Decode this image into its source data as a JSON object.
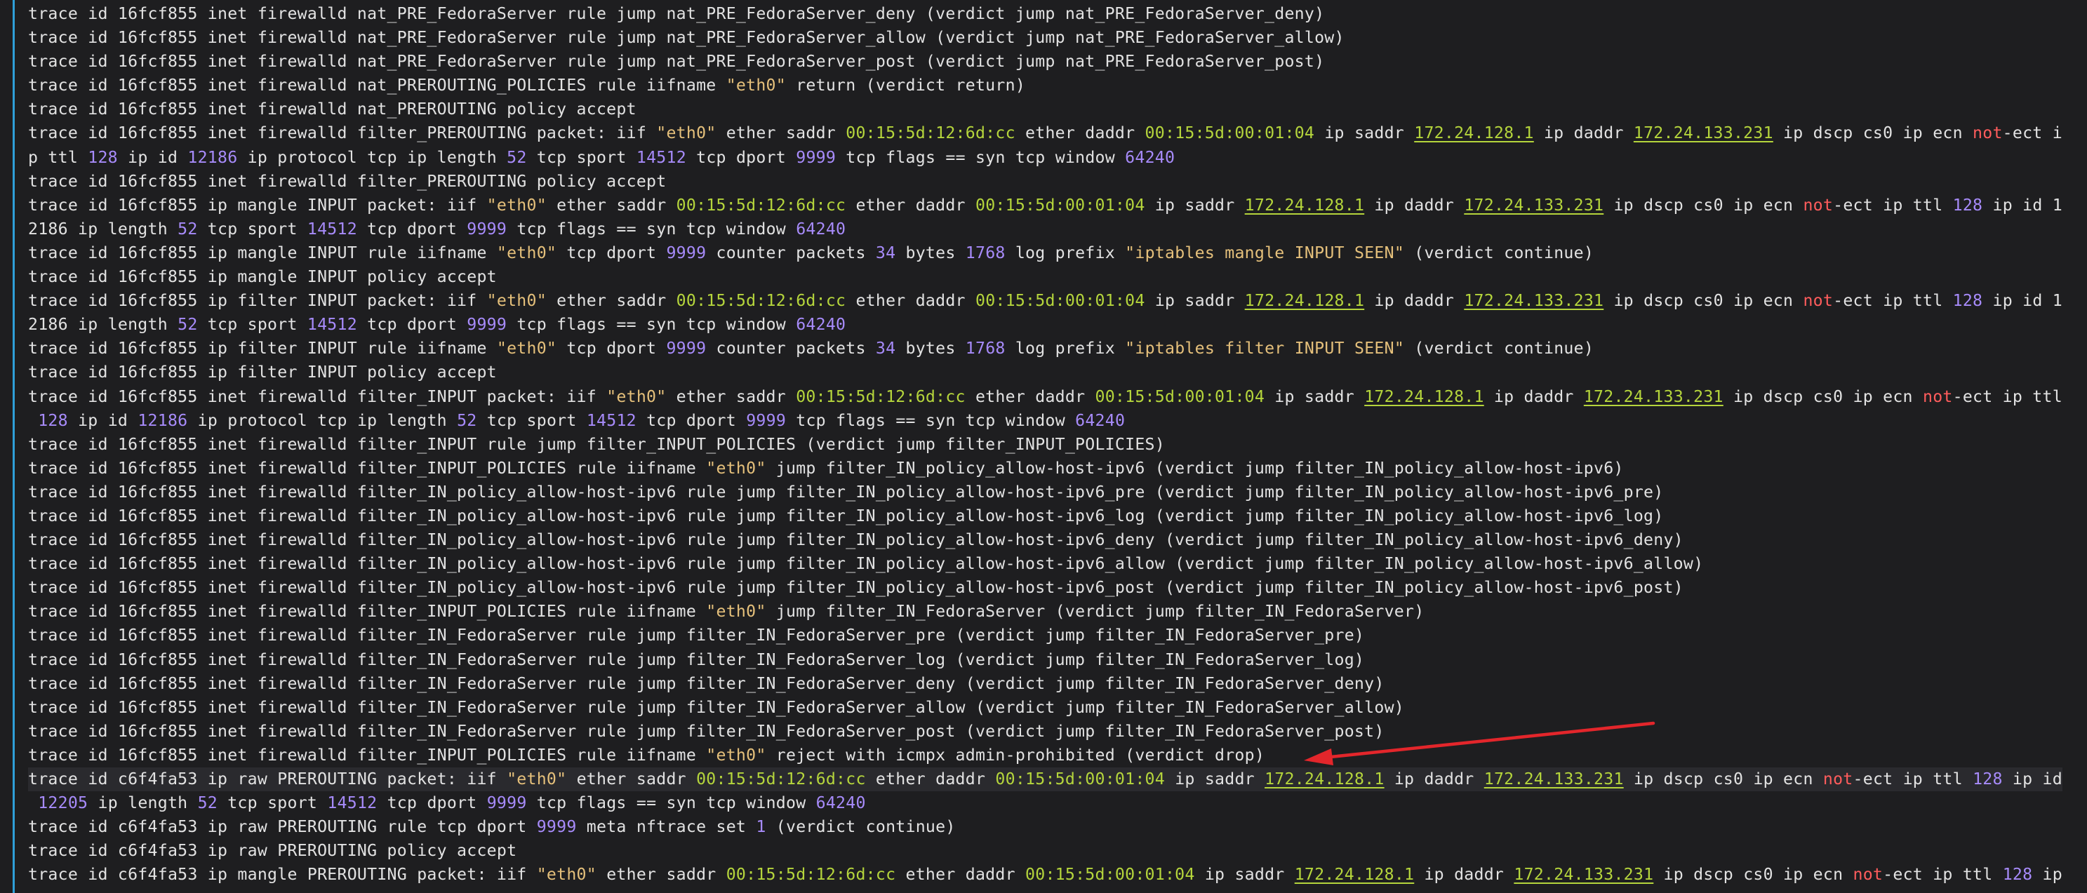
{
  "terminal": {
    "colors": {
      "background": "#1e1e20",
      "text": "#e2e2e2",
      "string": "#e5c07b",
      "number": "#a78bfa",
      "address": "#b5d53c",
      "negation": "#ff5c5c",
      "gutter_marker": "#2f9fd8",
      "annotation_arrow": "#e3262b"
    },
    "highlighted_line": 32,
    "arrow_points_to_line": 31,
    "lines": [
      [
        [
          "trace id 16fcf855 inet firewalld nat_PRE_FedoraServer rule jump nat_PRE_FedoraServer_deny (verdict jump nat_PRE_FedoraServer_deny)",
          ""
        ]
      ],
      [
        [
          "trace id 16fcf855 inet firewalld nat_PRE_FedoraServer rule jump nat_PRE_FedoraServer_allow (verdict jump nat_PRE_FedoraServer_allow)",
          ""
        ]
      ],
      [
        [
          "trace id 16fcf855 inet firewalld nat_PRE_FedoraServer rule jump nat_PRE_FedoraServer_post (verdict jump nat_PRE_FedoraServer_post)",
          ""
        ]
      ],
      [
        [
          "trace id 16fcf855 inet firewalld nat_PREROUTING_POLICIES rule iifname ",
          ""
        ],
        [
          "\"eth0\"",
          "s"
        ],
        [
          " return (verdict return)",
          ""
        ]
      ],
      [
        [
          "trace id 16fcf855 inet firewalld nat_PREROUTING policy accept",
          ""
        ]
      ],
      [
        [
          "trace id 16fcf855 inet firewalld filter_PREROUTING packet: iif ",
          ""
        ],
        [
          "\"eth0\"",
          "s"
        ],
        [
          " ether saddr ",
          ""
        ],
        [
          "00:15:5d:12:6d:cc",
          "mac"
        ],
        [
          " ether daddr ",
          ""
        ],
        [
          "00:15:5d:00:01:04",
          "mac"
        ],
        [
          " ip saddr ",
          ""
        ],
        [
          "172.24.128.1",
          "ip"
        ],
        [
          " ip daddr ",
          ""
        ],
        [
          "172.24.133.231",
          "ip"
        ],
        [
          " ip dscp cs0 ip ecn ",
          ""
        ],
        [
          "not",
          "red"
        ],
        [
          "-ect i",
          ""
        ]
      ],
      [
        [
          "p ttl ",
          ""
        ],
        [
          "128",
          "n"
        ],
        [
          " ip id ",
          ""
        ],
        [
          "12186",
          "n"
        ],
        [
          " ip protocol tcp ip length ",
          ""
        ],
        [
          "52",
          "n"
        ],
        [
          " tcp sport ",
          ""
        ],
        [
          "14512",
          "n"
        ],
        [
          " tcp dport ",
          ""
        ],
        [
          "9999",
          "n"
        ],
        [
          " tcp flags == syn tcp window ",
          ""
        ],
        [
          "64240",
          "n"
        ]
      ],
      [
        [
          "trace id 16fcf855 inet firewalld filter_PREROUTING policy accept",
          ""
        ]
      ],
      [
        [
          "trace id 16fcf855 ip mangle INPUT packet: iif ",
          ""
        ],
        [
          "\"eth0\"",
          "s"
        ],
        [
          " ether saddr ",
          ""
        ],
        [
          "00:15:5d:12:6d:cc",
          "mac"
        ],
        [
          " ether daddr ",
          ""
        ],
        [
          "00:15:5d:00:01:04",
          "mac"
        ],
        [
          " ip saddr ",
          ""
        ],
        [
          "172.24.128.1",
          "ip"
        ],
        [
          " ip daddr ",
          ""
        ],
        [
          "172.24.133.231",
          "ip"
        ],
        [
          " ip dscp cs0 ip ecn ",
          ""
        ],
        [
          "not",
          "red"
        ],
        [
          "-ect ip ttl ",
          ""
        ],
        [
          "128",
          "n"
        ],
        [
          " ip id 1",
          ""
        ]
      ],
      [
        [
          "2186 ip length ",
          ""
        ],
        [
          "52",
          "n"
        ],
        [
          " tcp sport ",
          ""
        ],
        [
          "14512",
          "n"
        ],
        [
          " tcp dport ",
          ""
        ],
        [
          "9999",
          "n"
        ],
        [
          " tcp flags == syn tcp window ",
          ""
        ],
        [
          "64240",
          "n"
        ]
      ],
      [
        [
          "trace id 16fcf855 ip mangle INPUT rule iifname ",
          ""
        ],
        [
          "\"eth0\"",
          "s"
        ],
        [
          " tcp dport ",
          ""
        ],
        [
          "9999",
          "n"
        ],
        [
          " counter packets ",
          ""
        ],
        [
          "34",
          "n"
        ],
        [
          " bytes ",
          ""
        ],
        [
          "1768",
          "n"
        ],
        [
          " log prefix ",
          ""
        ],
        [
          "\"iptables mangle INPUT SEEN\"",
          "s"
        ],
        [
          " (verdict continue)",
          ""
        ]
      ],
      [
        [
          "trace id 16fcf855 ip mangle INPUT policy accept",
          ""
        ]
      ],
      [
        [
          "trace id 16fcf855 ip filter INPUT packet: iif ",
          ""
        ],
        [
          "\"eth0\"",
          "s"
        ],
        [
          " ether saddr ",
          ""
        ],
        [
          "00:15:5d:12:6d:cc",
          "mac"
        ],
        [
          " ether daddr ",
          ""
        ],
        [
          "00:15:5d:00:01:04",
          "mac"
        ],
        [
          " ip saddr ",
          ""
        ],
        [
          "172.24.128.1",
          "ip"
        ],
        [
          " ip daddr ",
          ""
        ],
        [
          "172.24.133.231",
          "ip"
        ],
        [
          " ip dscp cs0 ip ecn ",
          ""
        ],
        [
          "not",
          "red"
        ],
        [
          "-ect ip ttl ",
          ""
        ],
        [
          "128",
          "n"
        ],
        [
          " ip id 1",
          ""
        ]
      ],
      [
        [
          "2186 ip length ",
          ""
        ],
        [
          "52",
          "n"
        ],
        [
          " tcp sport ",
          ""
        ],
        [
          "14512",
          "n"
        ],
        [
          " tcp dport ",
          ""
        ],
        [
          "9999",
          "n"
        ],
        [
          " tcp flags == syn tcp window ",
          ""
        ],
        [
          "64240",
          "n"
        ]
      ],
      [
        [
          "trace id 16fcf855 ip filter INPUT rule iifname ",
          ""
        ],
        [
          "\"eth0\"",
          "s"
        ],
        [
          " tcp dport ",
          ""
        ],
        [
          "9999",
          "n"
        ],
        [
          " counter packets ",
          ""
        ],
        [
          "34",
          "n"
        ],
        [
          " bytes ",
          ""
        ],
        [
          "1768",
          "n"
        ],
        [
          " log prefix ",
          ""
        ],
        [
          "\"iptables filter INPUT SEEN\"",
          "s"
        ],
        [
          " (verdict continue)",
          ""
        ]
      ],
      [
        [
          "trace id 16fcf855 ip filter INPUT policy accept",
          ""
        ]
      ],
      [
        [
          "trace id 16fcf855 inet firewalld filter_INPUT packet: iif ",
          ""
        ],
        [
          "\"eth0\"",
          "s"
        ],
        [
          " ether saddr ",
          ""
        ],
        [
          "00:15:5d:12:6d:cc",
          "mac"
        ],
        [
          " ether daddr ",
          ""
        ],
        [
          "00:15:5d:00:01:04",
          "mac"
        ],
        [
          " ip saddr ",
          ""
        ],
        [
          "172.24.128.1",
          "ip"
        ],
        [
          " ip daddr ",
          ""
        ],
        [
          "172.24.133.231",
          "ip"
        ],
        [
          " ip dscp cs0 ip ecn ",
          ""
        ],
        [
          "not",
          "red"
        ],
        [
          "-ect ip ttl",
          ""
        ]
      ],
      [
        [
          " ",
          ""
        ],
        [
          "128",
          "n"
        ],
        [
          " ip id ",
          ""
        ],
        [
          "12186",
          "n"
        ],
        [
          " ip protocol tcp ip length ",
          ""
        ],
        [
          "52",
          "n"
        ],
        [
          " tcp sport ",
          ""
        ],
        [
          "14512",
          "n"
        ],
        [
          " tcp dport ",
          ""
        ],
        [
          "9999",
          "n"
        ],
        [
          " tcp flags == syn tcp window ",
          ""
        ],
        [
          "64240",
          "n"
        ]
      ],
      [
        [
          "trace id 16fcf855 inet firewalld filter_INPUT rule jump filter_INPUT_POLICIES (verdict jump filter_INPUT_POLICIES)",
          ""
        ]
      ],
      [
        [
          "trace id 16fcf855 inet firewalld filter_INPUT_POLICIES rule iifname ",
          ""
        ],
        [
          "\"eth0\"",
          "s"
        ],
        [
          " jump filter_IN_policy_allow-host-ipv6 (verdict jump filter_IN_policy_allow-host-ipv6)",
          ""
        ]
      ],
      [
        [
          "trace id 16fcf855 inet firewalld filter_IN_policy_allow-host-ipv6 rule jump filter_IN_policy_allow-host-ipv6_pre (verdict jump filter_IN_policy_allow-host-ipv6_pre)",
          ""
        ]
      ],
      [
        [
          "trace id 16fcf855 inet firewalld filter_IN_policy_allow-host-ipv6 rule jump filter_IN_policy_allow-host-ipv6_log (verdict jump filter_IN_policy_allow-host-ipv6_log)",
          ""
        ]
      ],
      [
        [
          "trace id 16fcf855 inet firewalld filter_IN_policy_allow-host-ipv6 rule jump filter_IN_policy_allow-host-ipv6_deny (verdict jump filter_IN_policy_allow-host-ipv6_deny)",
          ""
        ]
      ],
      [
        [
          "trace id 16fcf855 inet firewalld filter_IN_policy_allow-host-ipv6 rule jump filter_IN_policy_allow-host-ipv6_allow (verdict jump filter_IN_policy_allow-host-ipv6_allow)",
          ""
        ]
      ],
      [
        [
          "trace id 16fcf855 inet firewalld filter_IN_policy_allow-host-ipv6 rule jump filter_IN_policy_allow-host-ipv6_post (verdict jump filter_IN_policy_allow-host-ipv6_post)",
          ""
        ]
      ],
      [
        [
          "trace id 16fcf855 inet firewalld filter_INPUT_POLICIES rule iifname ",
          ""
        ],
        [
          "\"eth0\"",
          "s"
        ],
        [
          " jump filter_IN_FedoraServer (verdict jump filter_IN_FedoraServer)",
          ""
        ]
      ],
      [
        [
          "trace id 16fcf855 inet firewalld filter_IN_FedoraServer rule jump filter_IN_FedoraServer_pre (verdict jump filter_IN_FedoraServer_pre)",
          ""
        ]
      ],
      [
        [
          "trace id 16fcf855 inet firewalld filter_IN_FedoraServer rule jump filter_IN_FedoraServer_log (verdict jump filter_IN_FedoraServer_log)",
          ""
        ]
      ],
      [
        [
          "trace id 16fcf855 inet firewalld filter_IN_FedoraServer rule jump filter_IN_FedoraServer_deny (verdict jump filter_IN_FedoraServer_deny)",
          ""
        ]
      ],
      [
        [
          "trace id 16fcf855 inet firewalld filter_IN_FedoraServer rule jump filter_IN_FedoraServer_allow (verdict jump filter_IN_FedoraServer_allow)",
          ""
        ]
      ],
      [
        [
          "trace id 16fcf855 inet firewalld filter_IN_FedoraServer rule jump filter_IN_FedoraServer_post (verdict jump filter_IN_FedoraServer_post)",
          ""
        ]
      ],
      [
        [
          "trace id 16fcf855 inet firewalld filter_INPUT_POLICIES rule iifname ",
          ""
        ],
        [
          "\"eth0\"",
          "s"
        ],
        [
          " reject with icmpx admin-prohibited (verdict drop)",
          ""
        ]
      ],
      [
        [
          "trace id c6f4fa53 ip raw PREROUTING packet: iif ",
          ""
        ],
        [
          "\"eth0\"",
          "s"
        ],
        [
          " ether saddr ",
          ""
        ],
        [
          "00:15:5d:12:6d:cc",
          "mac"
        ],
        [
          " ether daddr ",
          ""
        ],
        [
          "00:15:5d:00:01:04",
          "mac"
        ],
        [
          " ip saddr ",
          ""
        ],
        [
          "172.24.128.1",
          "ip"
        ],
        [
          " ip daddr ",
          ""
        ],
        [
          "172.24.133.231",
          "ip"
        ],
        [
          " ip dscp cs0 ip ecn ",
          ""
        ],
        [
          "not",
          "red"
        ],
        [
          "-ect ip ttl ",
          ""
        ],
        [
          "128",
          "n"
        ],
        [
          " ip id",
          ""
        ]
      ],
      [
        [
          " ",
          ""
        ],
        [
          "12205",
          "n"
        ],
        [
          " ip length ",
          ""
        ],
        [
          "52",
          "n"
        ],
        [
          " tcp sport ",
          ""
        ],
        [
          "14512",
          "n"
        ],
        [
          " tcp dport ",
          ""
        ],
        [
          "9999",
          "n"
        ],
        [
          " tcp flags == syn tcp window ",
          ""
        ],
        [
          "64240",
          "n"
        ]
      ],
      [
        [
          "trace id c6f4fa53 ip raw PREROUTING rule tcp dport ",
          ""
        ],
        [
          "9999",
          "n"
        ],
        [
          " meta nftrace set ",
          ""
        ],
        [
          "1",
          "n"
        ],
        [
          " (verdict continue)",
          ""
        ]
      ],
      [
        [
          "trace id c6f4fa53 ip raw PREROUTING policy accept",
          ""
        ]
      ],
      [
        [
          "trace id c6f4fa53 ip mangle PREROUTING packet: iif ",
          ""
        ],
        [
          "\"eth0\"",
          "s"
        ],
        [
          " ether saddr ",
          ""
        ],
        [
          "00:15:5d:12:6d:cc",
          "mac"
        ],
        [
          " ether daddr ",
          ""
        ],
        [
          "00:15:5d:00:01:04",
          "mac"
        ],
        [
          " ip saddr ",
          ""
        ],
        [
          "172.24.128.1",
          "ip"
        ],
        [
          " ip daddr ",
          ""
        ],
        [
          "172.24.133.231",
          "ip"
        ],
        [
          " ip dscp cs0 ip ecn ",
          ""
        ],
        [
          "not",
          "red"
        ],
        [
          "-ect ip ttl ",
          ""
        ],
        [
          "128",
          "n"
        ],
        [
          " ip",
          ""
        ]
      ]
    ]
  }
}
